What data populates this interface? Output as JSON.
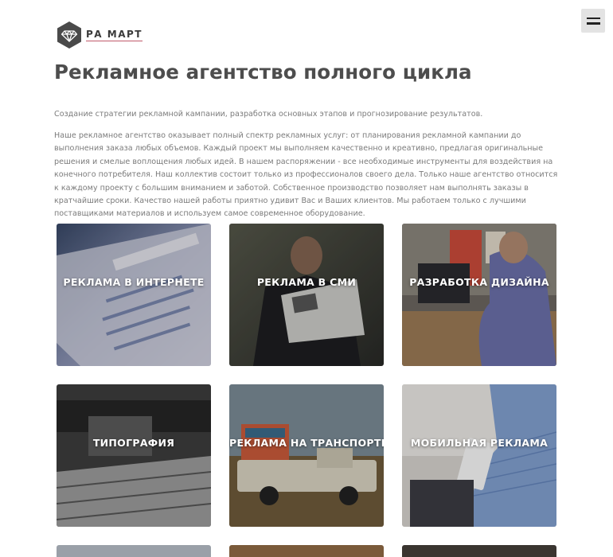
{
  "brand": {
    "name": "РА МАРТ",
    "logo_icon": "diamond-icon"
  },
  "menu": {
    "icon": "hamburger-icon"
  },
  "page": {
    "title": "Рекламное агентство полного цикла",
    "lead": "Создание стратегии рекламной кампании, разработка основных этапов и прогнозирование результатов.",
    "description": "Наше рекламное агентство оказывает полный спектр рекламных услуг: от планирования рекламной кампании до выполнения заказа любых объемов. Каждый проект мы выполняем качественно и креативно, предлагая оригинальные решения и смелые воплощения любых идей. В нашем распоряжении - все необходимые инструменты для воздействия на конечного потребителя. Наш коллектив состоит только из профессионалов своего дела. Только наше агентство относится к каждому проекту с большим вниманием и заботой. Собственное производство позволяет нам выполнять заказы в кратчайшие сроки. Качество нашей работы приятно удивит Вас и Ваших клиентов. Мы работаем только с лучшими поставщиками материалов и используем самое современное оборудование."
  },
  "services": [
    {
      "label": "РЕКЛАМА В ИНТЕРНЕТЕ"
    },
    {
      "label": "РЕКЛАМА В СМИ"
    },
    {
      "label": "РАЗРАБОТКА ДИЗАЙНА"
    },
    {
      "label": "ТИПОГРАФИЯ"
    },
    {
      "label": "РЕКЛАМА НА ТРАНСПОРТЕ"
    },
    {
      "label": "МОБИЛЬНАЯ РЕКЛАМА"
    }
  ],
  "colors": {
    "title": "#4d4d4d",
    "body_text": "#7b7b7b",
    "logo_underline": "#c05a6a",
    "menu_bg": "#e3e3e3"
  }
}
